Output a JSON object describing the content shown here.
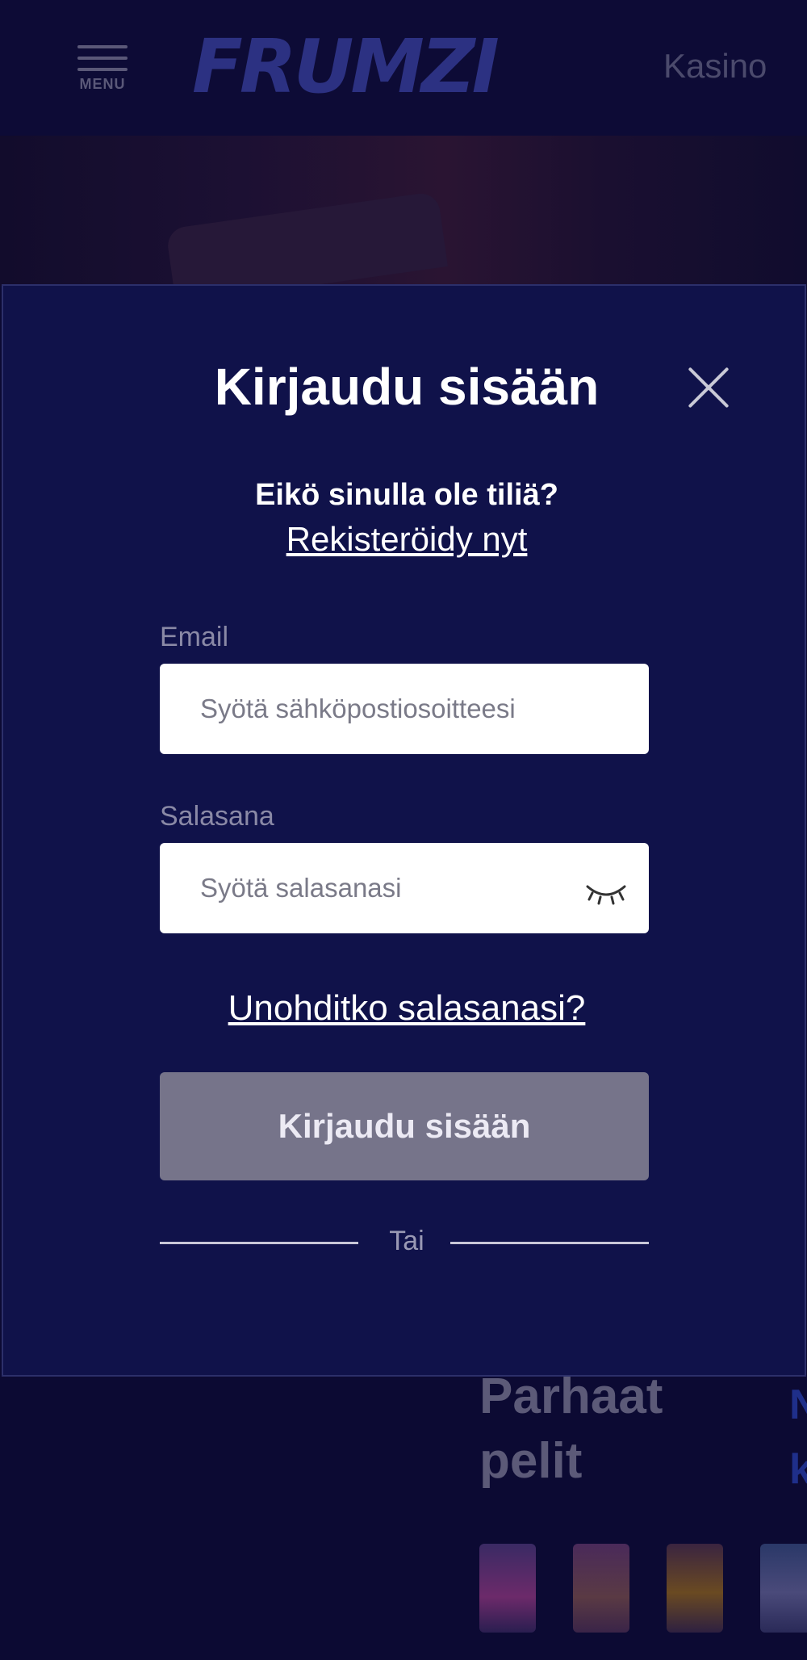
{
  "header": {
    "menu_label": "MENU",
    "logo_text": "FRUMZI",
    "nav_item": "Kasino"
  },
  "background": {
    "best_games_title": "Parhaat pelit",
    "side_letters": "N\nk"
  },
  "login_modal": {
    "title": "Kirjaudu sisään",
    "no_account_text": "Eikö sinulla ole tiliä?",
    "register_link": "Rekisteröidy nyt",
    "email": {
      "label": "Email",
      "placeholder": "Syötä sähköpostiosoitteesi",
      "value": ""
    },
    "password": {
      "label": "Salasana",
      "placeholder": "Syötä salasanasi",
      "value": ""
    },
    "forgot_link": "Unohditko salasanasi?",
    "submit_label": "Kirjaudu sisään",
    "divider_text": "Tai"
  },
  "colors": {
    "page_bg": "#0c0a33",
    "modal_bg": "#10124a",
    "button_disabled": "#76748a",
    "label": "#8a89a6"
  },
  "icons": {
    "close": "close-icon",
    "password_toggle": "eye-closed-icon",
    "menu": "hamburger-icon"
  }
}
